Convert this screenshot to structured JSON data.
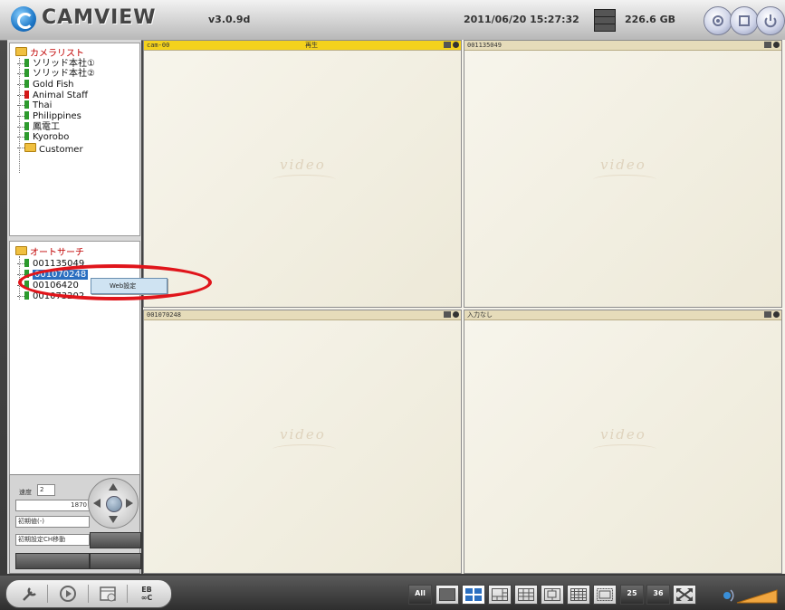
{
  "header": {
    "logo_text": "CAMVIEW",
    "version": "v3.0.9d",
    "datetime": "2011/06/20 15:27:32",
    "disk_free": "226.6 GB",
    "icons": [
      "settings-icon",
      "window-icon",
      "power-icon"
    ]
  },
  "camera_list": {
    "root_label": "カメラリスト",
    "items": [
      {
        "label": "ソリッド本社①",
        "color": "#2e9b2e"
      },
      {
        "label": "ソリッド本社②",
        "color": "#2e9b2e"
      },
      {
        "label": "Gold Fish",
        "color": "#2e9b2e"
      },
      {
        "label": "Animal Staff",
        "color": "#d41a1a"
      },
      {
        "label": "Thai",
        "color": "#2e9b2e"
      },
      {
        "label": "Philippines",
        "color": "#2e9b2e"
      },
      {
        "label": "鳳電工",
        "color": "#2e9b2e"
      },
      {
        "label": "Kyorobo",
        "color": "#2e9b2e"
      }
    ],
    "folder_label": "Customer"
  },
  "auto_search": {
    "root_label": "オートサーチ",
    "items": [
      {
        "label": "001135049",
        "selected": false
      },
      {
        "label": "001070248",
        "selected": true
      },
      {
        "label": "00106420",
        "selected": false
      },
      {
        "label": "001073202",
        "selected": false
      }
    ],
    "context_menu": {
      "item": "Web設定"
    }
  },
  "ptz": {
    "speed_label": "速度",
    "speed_value": "2",
    "step_value": "1870",
    "preset_select": "初期値(-)",
    "action_select": "初期設定CH移動"
  },
  "video": {
    "cells": [
      {
        "id": "cam-00",
        "status": "再生",
        "active": true,
        "watermark": "video"
      },
      {
        "id": "001135049",
        "status": "",
        "active": false,
        "watermark": "video"
      },
      {
        "id": "001070248",
        "status": "",
        "active": false,
        "watermark": "video"
      },
      {
        "id": "入力なし",
        "status": "",
        "active": false,
        "watermark": "video"
      }
    ]
  },
  "bottom_bar": {
    "ptz_ctrl_label_top": "EB",
    "ptz_ctrl_label_bottom": "∞C",
    "layouts": [
      "All",
      "1",
      "4",
      "6",
      "9",
      "10",
      "13",
      "16",
      "25",
      "36",
      "fullscreen"
    ],
    "layout_25": "25",
    "layout_36": "36",
    "layout_all": "All",
    "active_layout": "4"
  },
  "colors": {
    "accent": "#2b6fc0",
    "highlight_ellipse": "#e0151b",
    "active_bar": "#f4d21c"
  }
}
